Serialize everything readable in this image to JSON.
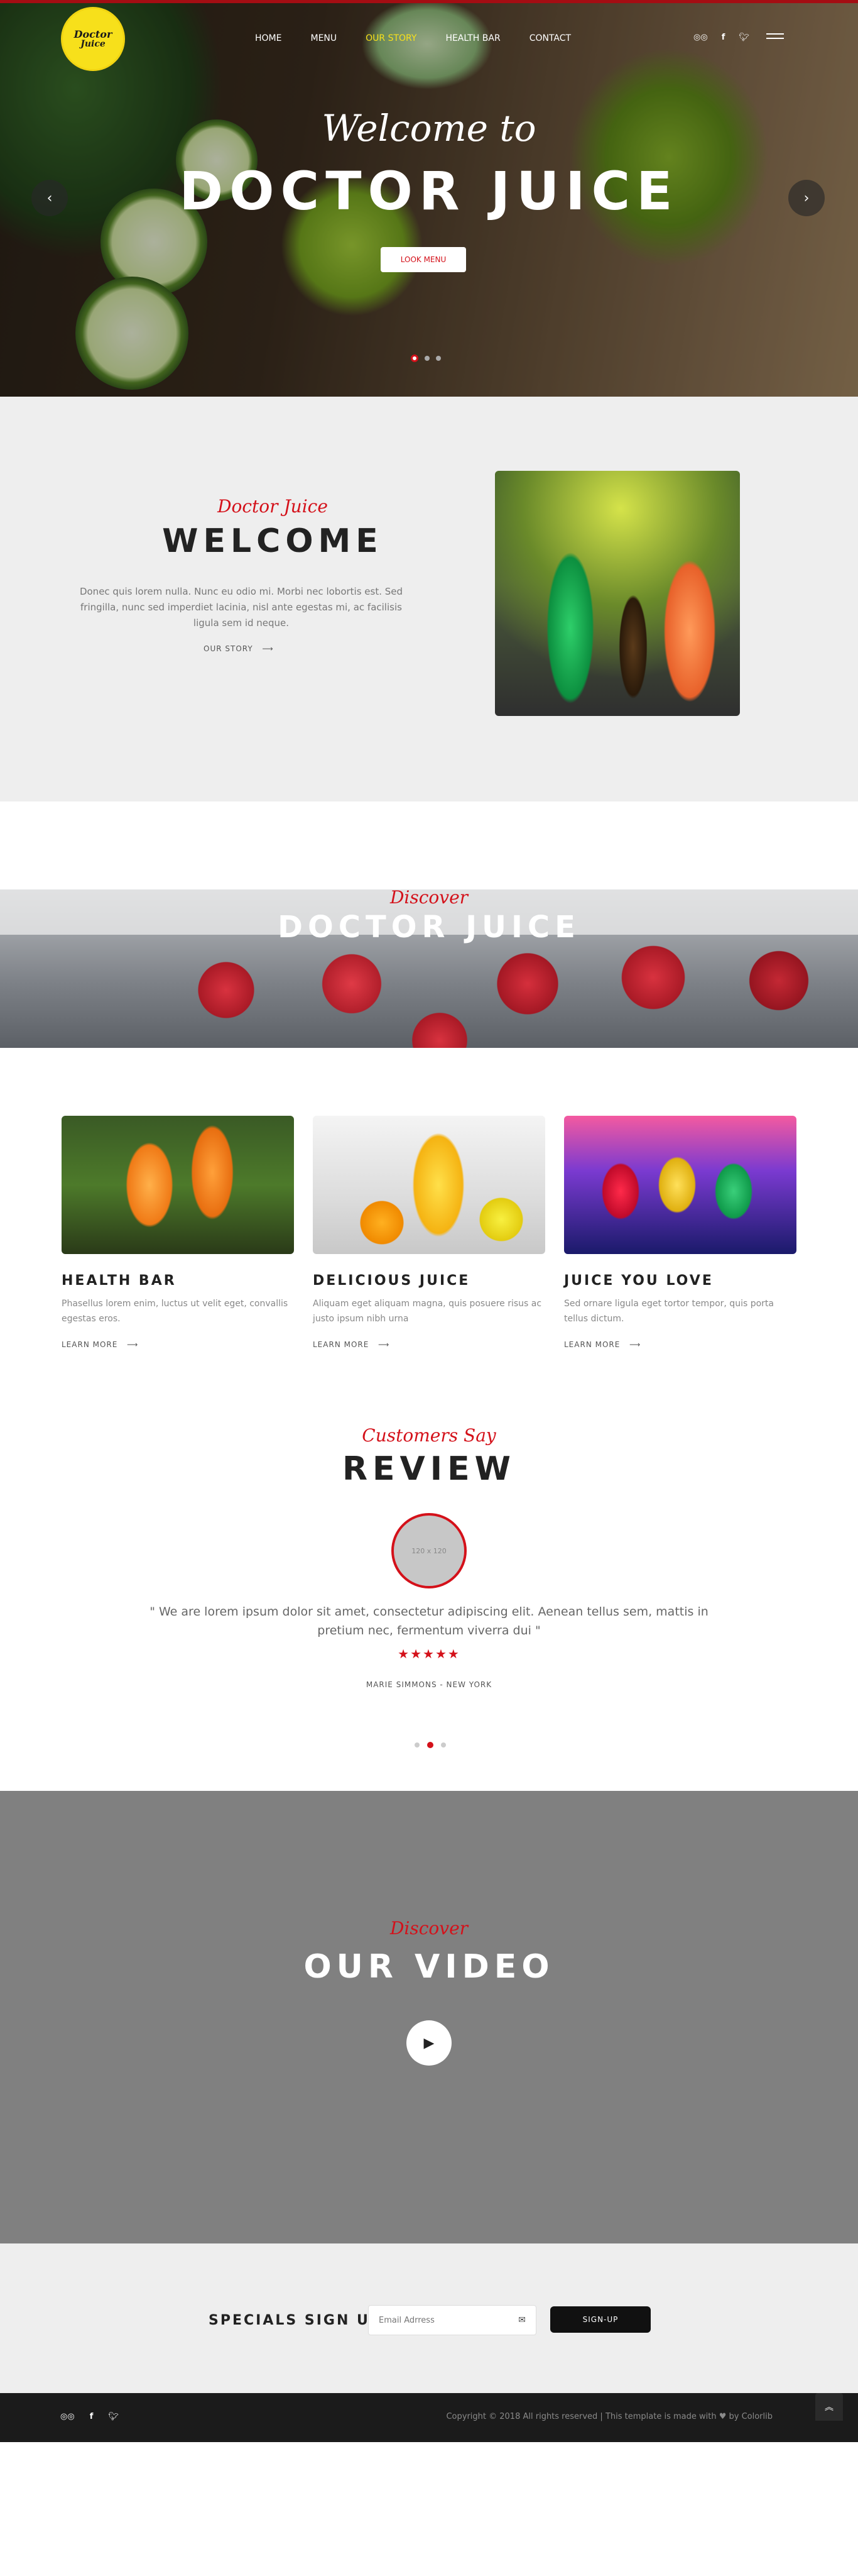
{
  "logo": {
    "line1": "Doctor",
    "line2": "Juice"
  },
  "nav": {
    "items": [
      {
        "label": "HOME"
      },
      {
        "label": "MENU"
      },
      {
        "label": "OUR STORY"
      },
      {
        "label": "HEALTH BAR"
      },
      {
        "label": "CONTACT"
      }
    ],
    "active_index": 2,
    "active_color": "#f7e01b"
  },
  "hero": {
    "title_script": "Welcome to",
    "title_main": "DOCTOR JUICE",
    "button_label": "LOOK MENU",
    "prev_icon": "chevron-left-icon",
    "next_icon": "chevron-right-icon",
    "slides_total": 3,
    "active_slide": 1
  },
  "social_icons": [
    "tripadvisor-icon",
    "facebook-icon",
    "twitter-icon"
  ],
  "welcome": {
    "subtitle": "Doctor Juice",
    "title": "WELCOME",
    "text": "Donec quis lorem nulla. Nunc eu odio mi. Morbi nec lobortis est. Sed fringilla, nunc sed imperdiet lacinia, nisl ante egestas mi, ac facilisis ligula sem id neque.",
    "link": "OUR STORY"
  },
  "discover_banner": {
    "subtitle": "Discover",
    "title": "DOCTOR JUICE"
  },
  "cards": [
    {
      "title": "HEALTH BAR",
      "text": "Phasellus lorem enim, luctus ut velit eget, convallis egestas eros.",
      "link": "LEARN MORE"
    },
    {
      "title": "DELICIOUS JUICE",
      "text": "Aliquam eget aliquam magna, quis posuere risus ac justo ipsum nibh urna",
      "link": "LEARN MORE"
    },
    {
      "title": "JUICE YOU LOVE",
      "text": "Sed ornare ligula eget tortor tempor, quis porta tellus dictum.",
      "link": "LEARN MORE"
    }
  ],
  "review": {
    "subtitle": "Customers Say",
    "title": "REVIEW",
    "avatar_text": "120 x 120",
    "quote": "\" We are lorem ipsum dolor sit amet, consectetur adipiscing elit. Aenean tellus sem, mattis in pretium nec, fermentum viverra dui \"",
    "stars": "★★★★★",
    "rating": 5,
    "author": "MARIE SIMMONS - NEW YORK",
    "slides_total": 3,
    "active_slide": 1
  },
  "video": {
    "subtitle": "Discover",
    "title": "OUR VIDEO",
    "play_icon": "play-icon"
  },
  "signup": {
    "label": "SPECIALS SIGN UP",
    "placeholder": "Email Adrress",
    "button": "SIGN-UP"
  },
  "footer": {
    "copyright": "Copyright © 2018 All rights reserved | This template is made with ♥ by ",
    "brand": "Colorlib",
    "back_to_top_icon": "double-chevron-up-icon"
  },
  "colors": {
    "accent": "#d4111a",
    "logo_yellow": "#f7e01b",
    "dark": "#111111"
  }
}
